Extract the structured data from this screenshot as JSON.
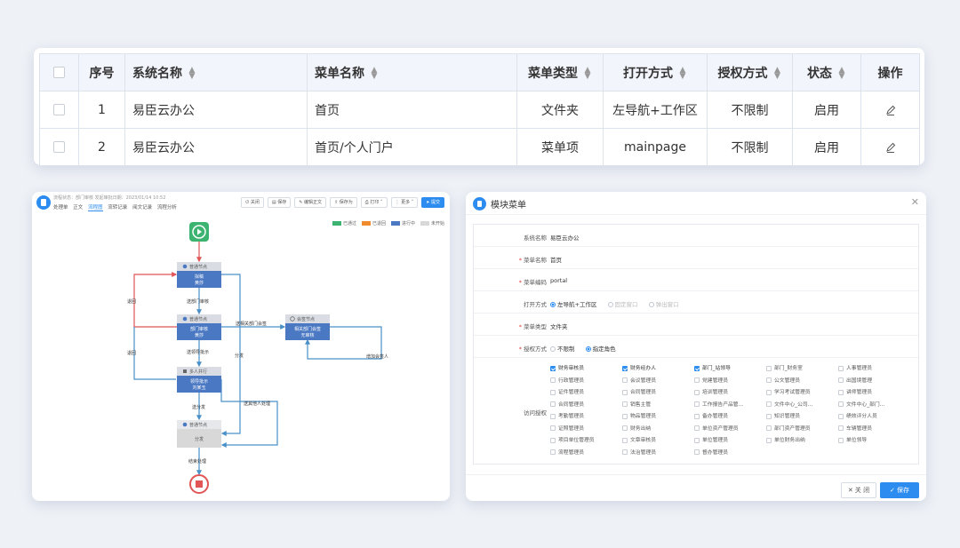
{
  "table": {
    "headers": {
      "seq": "序号",
      "system": "系统名称",
      "menu": "菜单名称",
      "type": "菜单类型",
      "open": "打开方式",
      "auth": "授权方式",
      "status": "状态",
      "ops": "操作"
    },
    "rows": [
      {
        "seq": "1",
        "system": "易臣云办公",
        "menu": "首页",
        "type": "文件夹",
        "open": "左导航+工作区",
        "auth": "不限制",
        "status": "启用"
      },
      {
        "seq": "2",
        "system": "易臣云办公",
        "menu": "首页/个人门户",
        "type": "菜单项",
        "open": "mainpage",
        "auth": "不限制",
        "status": "启用"
      }
    ]
  },
  "flow": {
    "meta": "流程状态：部门审核    发起审批日期：2023/01/14 10:52",
    "tabs": [
      "处理单",
      "正文",
      "流程图",
      "流转记录",
      "阅文记录",
      "流程分析"
    ],
    "active_tab": "流程图",
    "toolbar": [
      "关闭",
      "保存",
      "编辑正文",
      "保存为",
      "打印",
      "更多",
      "提交"
    ],
    "legend": [
      {
        "label": "已通过",
        "color": "#3cb371"
      },
      {
        "label": "已退回",
        "color": "#f08c2d"
      },
      {
        "label": "进行中",
        "color": "#4a78c2"
      },
      {
        "label": "未开始",
        "color": "#d8d8d8"
      }
    ],
    "nodes": {
      "n1_type": "普通节点",
      "n1_name": "拟稿",
      "n1_sub": "黄莎",
      "n2_type": "普通节点",
      "n2_name": "部门审核",
      "n2_sub": "黄莎",
      "n3_type": "会签节点",
      "n3_name": "相关部门会签",
      "n3_sub": "无审核",
      "n4_type": "多人并行",
      "n4_name": "领导批示",
      "n4_sub": "刘某玉",
      "n5_type": "普通节点",
      "n5_name": "分发"
    },
    "edges": {
      "e1": "送部门审核",
      "e2": "送领导批示",
      "e3": "送相关部门会签",
      "e4": "增加会签人",
      "e5": "退回",
      "e6": "退回",
      "e7": "分发",
      "e8": "送其他人处理",
      "e9": "送分发",
      "e10": "结束处理"
    }
  },
  "dialog": {
    "title": "模块菜单",
    "fields": {
      "system_label": "系统名称",
      "system_value": "易臣云办公",
      "menu_label": "菜单名称",
      "menu_value": "首页",
      "code_label": "菜单编码",
      "code_value": "portal",
      "open_label": "打开方式",
      "open_options": [
        "左导航+工作区",
        "固定窗口",
        "弹出窗口"
      ],
      "type_label": "菜单类型",
      "type_value": "文件夹",
      "auth_label": "授权方式",
      "auth_options": [
        "不限制",
        "指定角色"
      ],
      "access_label": "访问授权"
    },
    "roles": [
      {
        "name": "财务审核员",
        "checked": true
      },
      {
        "name": "财务经办人",
        "checked": true
      },
      {
        "name": "部门_站领导",
        "checked": true
      },
      {
        "name": "部门_财务室",
        "checked": false
      },
      {
        "name": "人事管理员",
        "checked": false
      },
      {
        "name": "行政管理员",
        "checked": false
      },
      {
        "name": "会议管理员",
        "checked": false
      },
      {
        "name": "党建管理员",
        "checked": false
      },
      {
        "name": "公文管理员",
        "checked": false
      },
      {
        "name": "出国境管理",
        "checked": false
      },
      {
        "name": "证件管理员",
        "checked": false
      },
      {
        "name": "合同管理员",
        "checked": false
      },
      {
        "name": "培训管理员",
        "checked": false
      },
      {
        "name": "学习考试管理员",
        "checked": false
      },
      {
        "name": "讲师管理员",
        "checked": false
      },
      {
        "name": "合同管理员",
        "checked": false
      },
      {
        "name": "销售主管",
        "checked": false
      },
      {
        "name": "工作报告产品管...",
        "checked": false
      },
      {
        "name": "文件中心_公司...",
        "checked": false
      },
      {
        "name": "文件中心_部门...",
        "checked": false
      },
      {
        "name": "考勤管理员",
        "checked": false
      },
      {
        "name": "物品管理员",
        "checked": false
      },
      {
        "name": "备办管理员",
        "checked": false
      },
      {
        "name": "知识管理员",
        "checked": false
      },
      {
        "name": "绩效评分人员",
        "checked": false
      },
      {
        "name": "证照管理员",
        "checked": false
      },
      {
        "name": "财务出纳",
        "checked": false
      },
      {
        "name": "单位资产管理员",
        "checked": false
      },
      {
        "name": "部门资产管理员",
        "checked": false
      },
      {
        "name": "车辆管理员",
        "checked": false
      },
      {
        "name": "项目单位管理员",
        "checked": false
      },
      {
        "name": "文章审核员",
        "checked": false
      },
      {
        "name": "单位管理员",
        "checked": false
      },
      {
        "name": "单位财务出纳",
        "checked": false
      },
      {
        "name": "单位领导",
        "checked": false
      },
      {
        "name": "流程管理员",
        "checked": false
      },
      {
        "name": "法治管理员",
        "checked": false
      },
      {
        "name": "督办管理员",
        "checked": false
      }
    ],
    "buttons": {
      "close": "关 闭",
      "save": "保存"
    }
  }
}
